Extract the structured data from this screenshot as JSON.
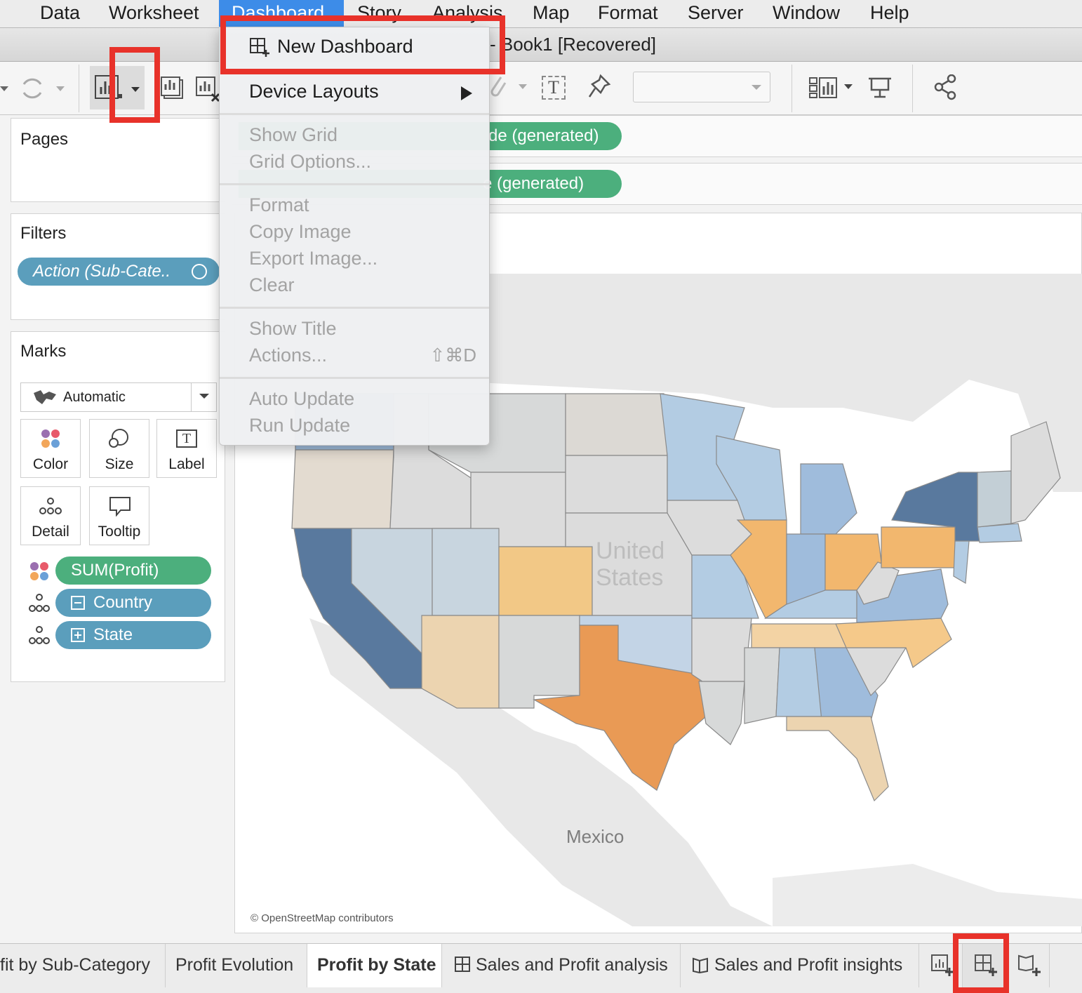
{
  "menubar": {
    "items": [
      "Data",
      "Worksheet",
      "Dashboard",
      "Story",
      "Analysis",
      "Map",
      "Format",
      "Server",
      "Window",
      "Help"
    ],
    "active": "Dashboard"
  },
  "window": {
    "title": "- Book1 [Recovered]"
  },
  "dashboard_menu": {
    "new_dashboard": "New Dashboard",
    "device_layouts": "Device Layouts",
    "show_grid": "Show Grid",
    "grid_options": "Grid Options...",
    "format": "Format",
    "copy_image": "Copy Image",
    "export_image": "Export Image...",
    "clear": "Clear",
    "show_title": "Show Title",
    "actions": "Actions...",
    "actions_shortcut": "⇧⌘D",
    "auto_update": "Auto Update",
    "run_update": "Run Update"
  },
  "shelves": {
    "columns_pill": "de (generated)",
    "rows_pill": "e (generated)"
  },
  "panels": {
    "pages_title": "Pages",
    "filters_title": "Filters",
    "filter_pill": "Action (Sub-Cate..",
    "marks_title": "Marks",
    "mark_type": "Automatic",
    "mark_buttons": {
      "color": "Color",
      "size": "Size",
      "label": "Label",
      "detail": "Detail",
      "tooltip": "Tooltip"
    },
    "label_glyph": "T",
    "pills": {
      "profit": "SUM(Profit)",
      "country": "Country",
      "state": "State"
    }
  },
  "map": {
    "labels": {
      "united": "United",
      "states": "States",
      "mexico": "Mexico"
    },
    "attribution": "© OpenStreetMap contributors",
    "colors": {
      "dark_blue": "#59799e",
      "mid_blue": "#9fbcdc",
      "light_blue": "#c3d4e6",
      "neutral": "#dcdcdc",
      "light_orange": "#ecd4b0",
      "orange": "#f2b76e",
      "dark_orange": "#e99a55",
      "land": "#e8e8e8",
      "water": "#ffffff"
    }
  },
  "tabs": {
    "items": [
      {
        "label": "fit by Sub-Category",
        "active": false
      },
      {
        "label": "Profit Evolution",
        "active": false
      },
      {
        "label": "Profit by State",
        "active": true
      },
      {
        "label": "Sales and Profit analysis",
        "active": false
      },
      {
        "label": "Sales and Profit insights",
        "active": false
      }
    ]
  },
  "highlight_color": "#e8322a"
}
